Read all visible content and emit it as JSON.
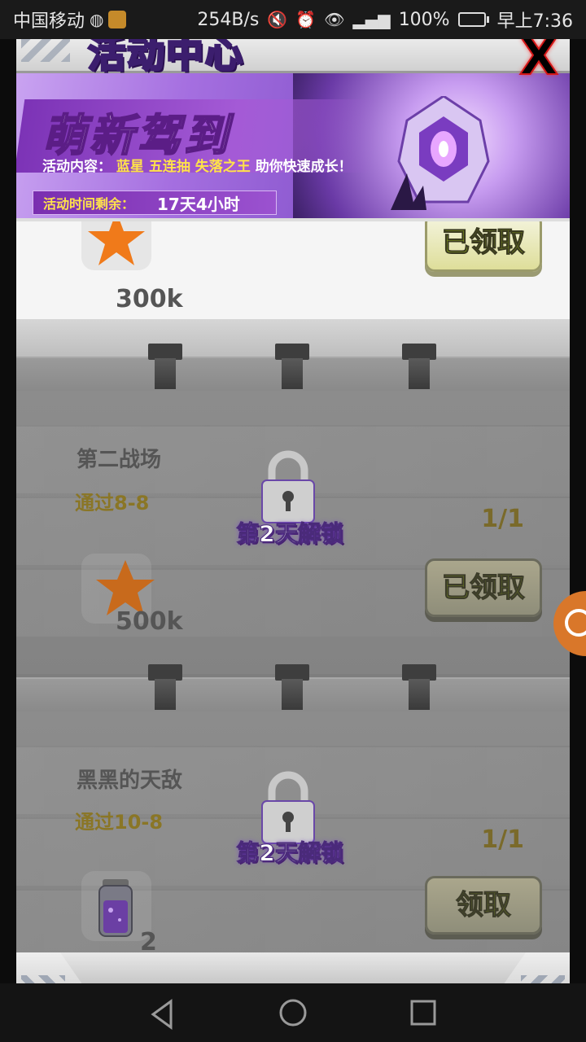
{
  "status_bar": {
    "carrier": "中国移动",
    "speed": "254B/s",
    "battery": "100%",
    "time": "早上7:36"
  },
  "header": {
    "title": "活动中心",
    "close_label": "X"
  },
  "banner": {
    "title": "萌新驾到",
    "content_prefix": "活动内容：",
    "content_items": [
      "蓝星",
      "五连抽",
      "失落之王"
    ],
    "content_suffix": "助你快速成长！",
    "time_label": "活动时间剩余：",
    "time_value": "17天4小时"
  },
  "previous_task": {
    "reward_amount": "300k",
    "button_label": "已领取"
  },
  "tasks": [
    {
      "name": "第二战场",
      "condition": "通过8-8",
      "progress": "1/1",
      "lock_text": "第2天解锁",
      "reward_icon": "star-icon",
      "reward_amount": "500k",
      "button_label": "已领取"
    },
    {
      "name": "黑黑的天敌",
      "condition": "通过10-8",
      "progress": "1/1",
      "lock_text": "第2天解锁",
      "reward_icon": "potion-icon",
      "reward_amount": "2",
      "button_label": "领取"
    }
  ],
  "colors": {
    "banner_purple": "#9b52d0",
    "highlight_yellow": "#ffe34a",
    "star_orange": "#f07a1a",
    "close_red": "#d41818"
  }
}
